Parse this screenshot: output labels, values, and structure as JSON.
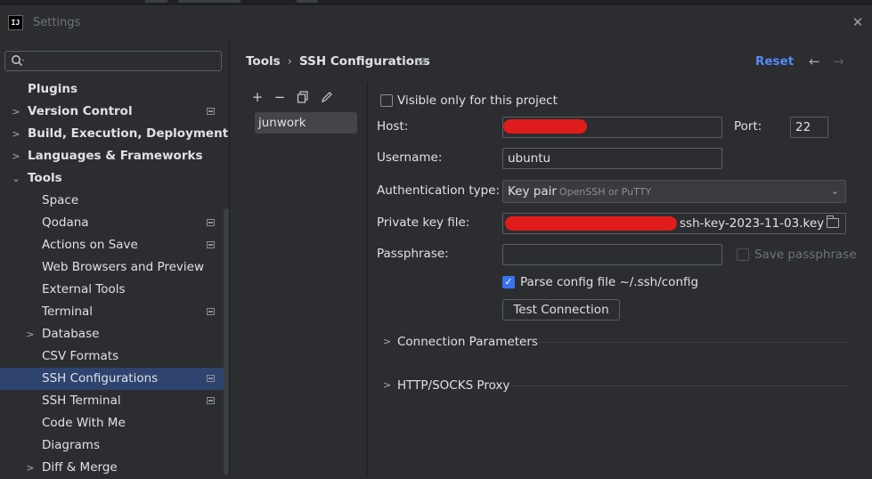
{
  "window": {
    "title": "Settings",
    "logo_text": "IJ"
  },
  "sidebar": {
    "search": {
      "placeholder": "",
      "value": ""
    },
    "items": [
      {
        "label": "Plugins",
        "bold": true,
        "arrow": "",
        "level": 0,
        "indicator": false,
        "selected": false
      },
      {
        "label": "Version Control",
        "bold": true,
        "arrow": ">",
        "level": 0,
        "indicator": true,
        "selected": false
      },
      {
        "label": "Build, Execution, Deployment",
        "bold": true,
        "arrow": ">",
        "level": 0,
        "indicator": false,
        "selected": false
      },
      {
        "label": "Languages & Frameworks",
        "bold": true,
        "arrow": ">",
        "level": 0,
        "indicator": false,
        "selected": false
      },
      {
        "label": "Tools",
        "bold": true,
        "arrow": "v",
        "level": 0,
        "indicator": false,
        "selected": false
      },
      {
        "label": "Space",
        "bold": false,
        "arrow": "",
        "level": 1,
        "indicator": false,
        "selected": false
      },
      {
        "label": "Qodana",
        "bold": false,
        "arrow": "",
        "level": 1,
        "indicator": true,
        "selected": false
      },
      {
        "label": "Actions on Save",
        "bold": false,
        "arrow": "",
        "level": 1,
        "indicator": true,
        "selected": false
      },
      {
        "label": "Web Browsers and Preview",
        "bold": false,
        "arrow": "",
        "level": 1,
        "indicator": false,
        "selected": false
      },
      {
        "label": "External Tools",
        "bold": false,
        "arrow": "",
        "level": 1,
        "indicator": false,
        "selected": false
      },
      {
        "label": "Terminal",
        "bold": false,
        "arrow": "",
        "level": 1,
        "indicator": true,
        "selected": false
      },
      {
        "label": "Database",
        "bold": false,
        "arrow": ">",
        "level": 1,
        "indicator": false,
        "selected": false
      },
      {
        "label": "CSV Formats",
        "bold": false,
        "arrow": "",
        "level": 1,
        "indicator": false,
        "selected": false
      },
      {
        "label": "SSH Configurations",
        "bold": false,
        "arrow": "",
        "level": 1,
        "indicator": true,
        "selected": true
      },
      {
        "label": "SSH Terminal",
        "bold": false,
        "arrow": "",
        "level": 1,
        "indicator": true,
        "selected": false
      },
      {
        "label": "Code With Me",
        "bold": false,
        "arrow": "",
        "level": 1,
        "indicator": false,
        "selected": false
      },
      {
        "label": "Diagrams",
        "bold": false,
        "arrow": "",
        "level": 1,
        "indicator": false,
        "selected": false
      },
      {
        "label": "Diff & Merge",
        "bold": false,
        "arrow": ">",
        "level": 1,
        "indicator": false,
        "selected": false
      }
    ]
  },
  "header": {
    "breadcrumb": [
      "Tools",
      "SSH Configurations"
    ],
    "separator": "›",
    "reset_label": "Reset",
    "back_icon": "arrow-left-icon",
    "forward_icon": "arrow-right-icon"
  },
  "list": {
    "toolbar": [
      "add-icon",
      "remove-icon",
      "copy-icon",
      "edit-icon"
    ],
    "items": [
      "junwork"
    ]
  },
  "form": {
    "visible_only_label": "Visible only for this project",
    "visible_only_checked": false,
    "host_label": "Host:",
    "host_value": "",
    "port_label": "Port:",
    "port_value": "22",
    "username_label": "Username:",
    "username_value": "ubuntu",
    "auth_type_label": "Authentication type:",
    "auth_type_value": "Key pair",
    "auth_type_hint": "OpenSSH or PuTTY",
    "private_key_label": "Private key file:",
    "private_key_value": "ssh-key-2023-11-03.key",
    "passphrase_label": "Passphrase:",
    "passphrase_value": "",
    "save_passphrase_label": "Save passphrase",
    "save_passphrase_checked": false,
    "parse_config_label": "Parse config file ~/.ssh/config",
    "parse_config_checked": true,
    "test_connection_label": "Test Connection",
    "sections": [
      "Connection Parameters",
      "HTTP/SOCKS Proxy"
    ]
  },
  "colors": {
    "background": "#2b2d30",
    "selection": "#2e436e",
    "accent": "#548af7",
    "checkbox_checked": "#3574f0",
    "redaction": "#e01b1b"
  }
}
